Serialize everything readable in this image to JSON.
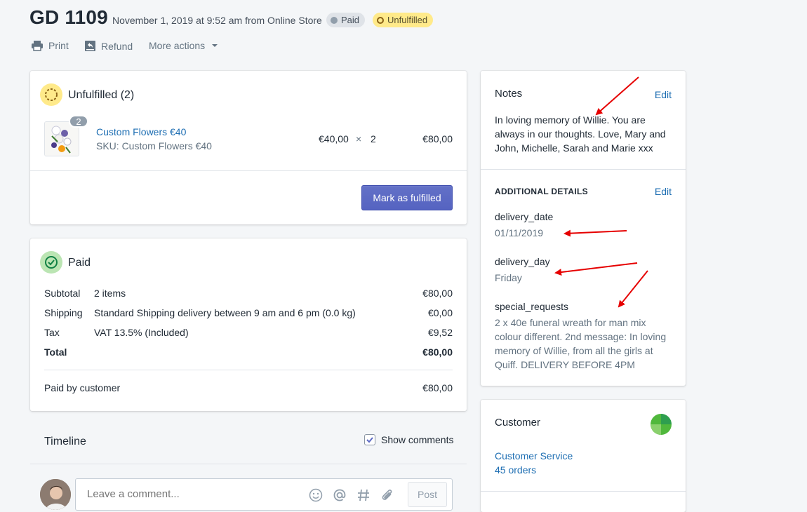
{
  "header": {
    "order_number": "GD 1109",
    "meta": "November 1, 2019 at 9:52 am from Online Store",
    "badges": {
      "paid": "Paid",
      "unfulfilled": "Unfulfilled"
    },
    "actions": {
      "print": "Print",
      "refund": "Refund",
      "more": "More actions"
    }
  },
  "unfulfilled": {
    "title": "Unfulfilled (2)",
    "item": {
      "qty_badge": "2",
      "name": "Custom Flowers €40",
      "sku": "SKU: Custom Flowers €40",
      "unit_price": "€40,00",
      "times": "×",
      "quantity": "2",
      "total": "€80,00"
    },
    "button": "Mark as fulfilled"
  },
  "paid": {
    "title": "Paid",
    "rows": [
      {
        "label": "Subtotal",
        "desc": "2 items",
        "value": "€80,00"
      },
      {
        "label": "Shipping",
        "desc": "Standard Shipping delivery between 9 am and 6 pm (0.0 kg)",
        "value": "€0,00"
      },
      {
        "label": "Tax",
        "desc": "VAT 13.5% (Included)",
        "value": "€9,52"
      }
    ],
    "total_label": "Total",
    "total_value": "€80,00",
    "paid_by_label": "Paid by customer",
    "paid_by_value": "€80,00"
  },
  "timeline": {
    "title": "Timeline",
    "show_comments": "Show comments",
    "show_comments_checked": true,
    "comment_placeholder": "Leave a comment...",
    "post": "Post"
  },
  "notes": {
    "title": "Notes",
    "edit": "Edit",
    "text": "In loving memory of Willie. You are always in our thoughts. Love, Mary and John, Michelle, Sarah and Marie xxx"
  },
  "additional": {
    "title": "ADDITIONAL DETAILS",
    "edit": "Edit",
    "fields": [
      {
        "key": "delivery_date",
        "value": "01/11/2019"
      },
      {
        "key": "delivery_day",
        "value": "Friday"
      },
      {
        "key": "special_requests",
        "value": "2 x 40e funeral wreath for man mix colour different. 2nd message: In loving memory of Willie, from all the girls at Quiff. DELIVERY BEFORE 4PM"
      }
    ]
  },
  "customer": {
    "title": "Customer",
    "name": "Customer Service",
    "orders": "45 orders"
  },
  "colors": {
    "annotation_arrow": "#e60000",
    "primary_button": "#5c6ac4",
    "paid_badge": "#dfe3e8",
    "unfulfilled_badge": "#ffea8a",
    "link": "#1f6fb3"
  },
  "icons": [
    "printer-icon",
    "refund-icon",
    "caret-down-icon",
    "unfulfilled-ring-icon",
    "check-circle-icon",
    "emoji-icon",
    "at-icon",
    "hashtag-icon",
    "paperclip-icon",
    "checkbox-icon",
    "avatar"
  ]
}
